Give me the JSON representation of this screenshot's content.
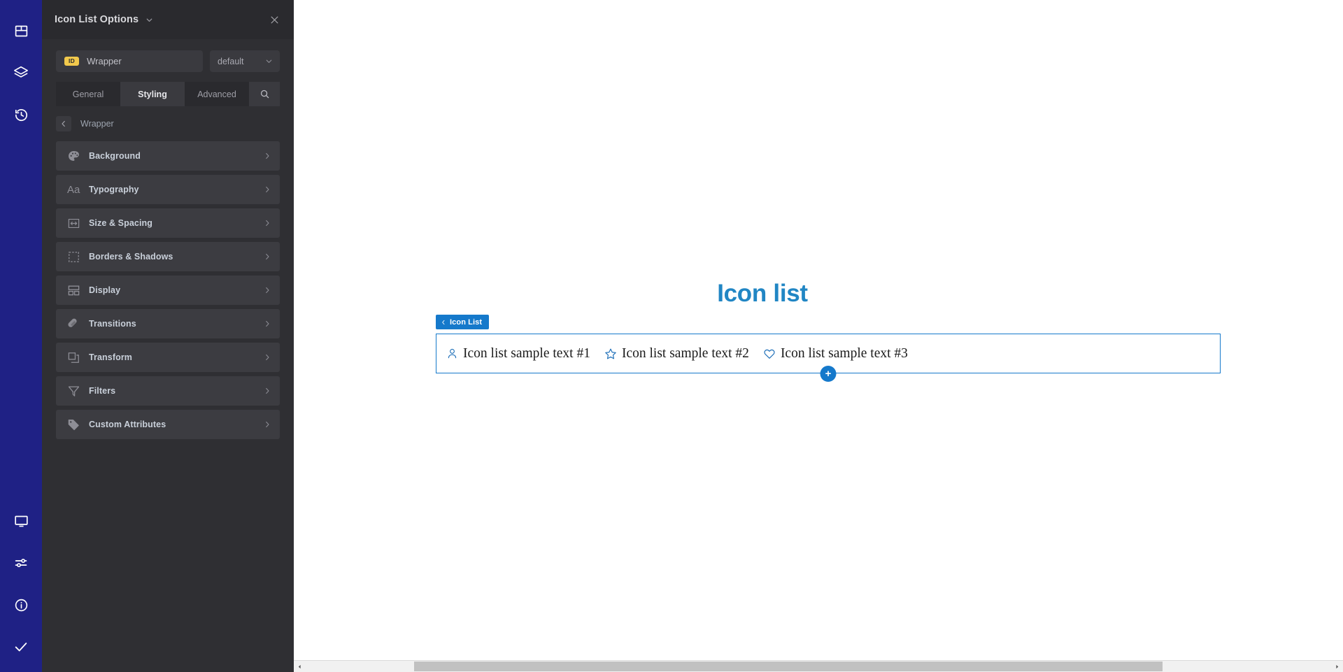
{
  "rail": {
    "items": [
      {
        "name": "layout-icon",
        "label": "Layout"
      },
      {
        "name": "layers-icon",
        "label": "Layers"
      },
      {
        "name": "history-icon",
        "label": "History"
      }
    ],
    "bottom_items": [
      {
        "name": "monitor-icon",
        "label": "Responsive"
      },
      {
        "name": "sliders-icon",
        "label": "Settings"
      },
      {
        "name": "info-icon",
        "label": "Info"
      },
      {
        "name": "check-icon",
        "label": "Save"
      }
    ],
    "color": "#1F2185"
  },
  "panel": {
    "title": "Icon List Options",
    "title_caret": "chevron-down-icon",
    "close": "close-icon",
    "selector": {
      "id_chip": "ID",
      "element_label": "Wrapper",
      "state_value": "default",
      "state_caret": "chevron-down-icon"
    },
    "tabs": [
      {
        "label": "General",
        "active": false
      },
      {
        "label": "Styling",
        "active": true
      },
      {
        "label": "Advanced",
        "active": false
      }
    ],
    "search_icon": "search-icon",
    "breadcrumb": {
      "back_icon": "chevron-left-icon",
      "label": "Wrapper"
    },
    "sections": [
      {
        "label": "Background",
        "icon": "palette-icon"
      },
      {
        "label": "Typography",
        "icon": "typography-icon"
      },
      {
        "label": "Size & Spacing",
        "icon": "resize-horizontal-icon"
      },
      {
        "label": "Borders & Shadows",
        "icon": "dashed-square-icon"
      },
      {
        "label": "Display",
        "icon": "layout-blocks-icon"
      },
      {
        "label": "Transitions",
        "icon": "capsule-icon"
      },
      {
        "label": "Transform",
        "icon": "overlapping-squares-icon"
      },
      {
        "label": "Filters",
        "icon": "funnel-icon"
      },
      {
        "label": "Custom Attributes",
        "icon": "tag-icon"
      }
    ],
    "section_chevron": "chevron-right-icon",
    "accent_id_chip": "#F2C94C",
    "background": "#2F2F33"
  },
  "canvas": {
    "heading": "Icon list",
    "heading_color": "#2186C4",
    "widget_badge": {
      "chevron": "chevron-left-icon",
      "label": "Icon List"
    },
    "icon_list": [
      {
        "icon": "user-icon",
        "text": "Icon list sample text #1"
      },
      {
        "icon": "star-icon",
        "text": "Icon list sample text #2"
      },
      {
        "icon": "heart-icon",
        "text": "Icon list sample text #3"
      }
    ],
    "add_button": "+",
    "accent": "#1579CB"
  },
  "scrollbar": {
    "left_arrow": "chevron-left-icon",
    "right_arrow": "chevron-right-icon"
  }
}
